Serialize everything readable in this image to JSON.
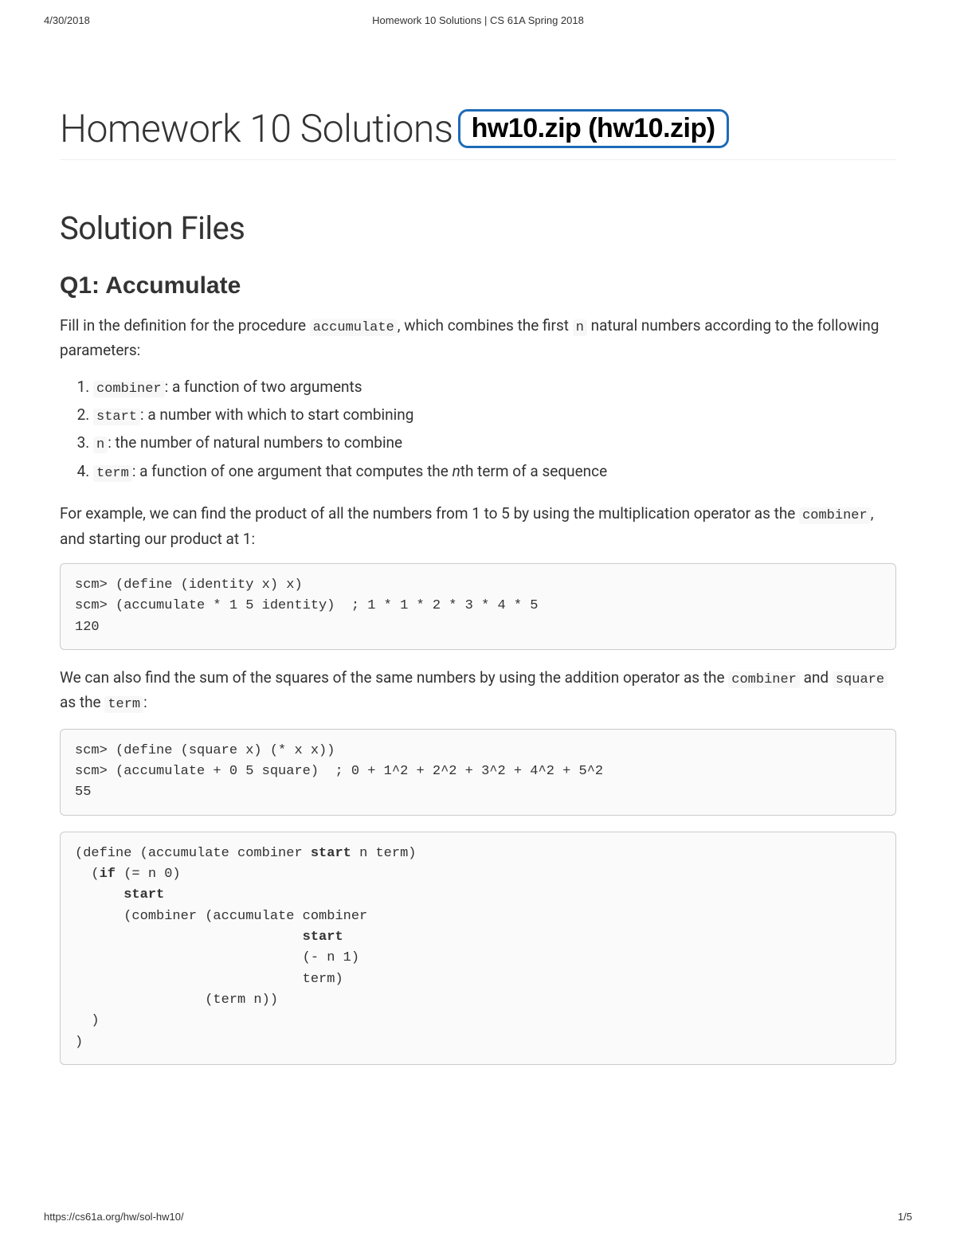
{
  "print_header": {
    "date": "4/30/2018",
    "title": "Homework 10 Solutions | CS 61A Spring 2018"
  },
  "page": {
    "title": "Homework 10 Solutions",
    "zip_link": "hw10.zip (hw10.zip)"
  },
  "section": {
    "heading": "Solution Files"
  },
  "q1": {
    "heading": "Q1: Accumulate",
    "intro_before_code1": "Fill in the definition for the procedure ",
    "code1": "accumulate",
    "intro_mid1": ", which combines the first ",
    "code2": "n",
    "intro_after": " natural numbers according to the following parameters:",
    "params": [
      {
        "code": "combiner",
        "desc": ": a function of two arguments"
      },
      {
        "code": "start",
        "desc": ": a number with which to start combining"
      },
      {
        "code": "n",
        "desc": ": the number of natural numbers to combine"
      },
      {
        "code": "term",
        "desc_before": ": a function of one argument that computes the ",
        "italic": "n",
        "desc_after": "th term of a sequence"
      }
    ],
    "example1_before": "For example, we can find the product of all the numbers from 1 to 5 by using the multiplication operator as the ",
    "example1_code": "combiner",
    "example1_after": ", and starting our product at 1:",
    "codeblock1": "scm> (define (identity x) x)\nscm> (accumulate * 1 5 identity)  ; 1 * 1 * 2 * 3 * 4 * 5\n120",
    "example2_before": "We can also find the sum of the squares of the same numbers by using the addition operator as the ",
    "example2_code1": "combiner",
    "example2_mid": " and ",
    "example2_code2": "square",
    "example2_mid2": " as the ",
    "example2_code3": "term",
    "example2_after": ":",
    "codeblock2": "scm> (define (square x) (* x x))\nscm> (accumulate + 0 5 square)  ; 0 + 1^2 + 2^2 + 3^2 + 4^2 + 5^2\n55",
    "codeblock3_lines": [
      {
        "pre": "(define (accumulate combiner ",
        "bold": "start",
        "post": " n term)"
      },
      {
        "pre": "  (",
        "bold": "if",
        "post": " (= n 0)"
      },
      {
        "pre": "      ",
        "bold": "start",
        "post": ""
      },
      {
        "pre": "      (combiner (accumulate combiner",
        "bold": "",
        "post": ""
      },
      {
        "pre": "                            ",
        "bold": "start",
        "post": ""
      },
      {
        "pre": "                            (- n 1)",
        "bold": "",
        "post": ""
      },
      {
        "pre": "                            term)",
        "bold": "",
        "post": ""
      },
      {
        "pre": "                (term n))",
        "bold": "",
        "post": ""
      },
      {
        "pre": "  )",
        "bold": "",
        "post": ""
      },
      {
        "pre": ")",
        "bold": "",
        "post": ""
      }
    ]
  },
  "print_footer": {
    "url": "https://cs61a.org/hw/sol-hw10/",
    "page": "1/5"
  }
}
